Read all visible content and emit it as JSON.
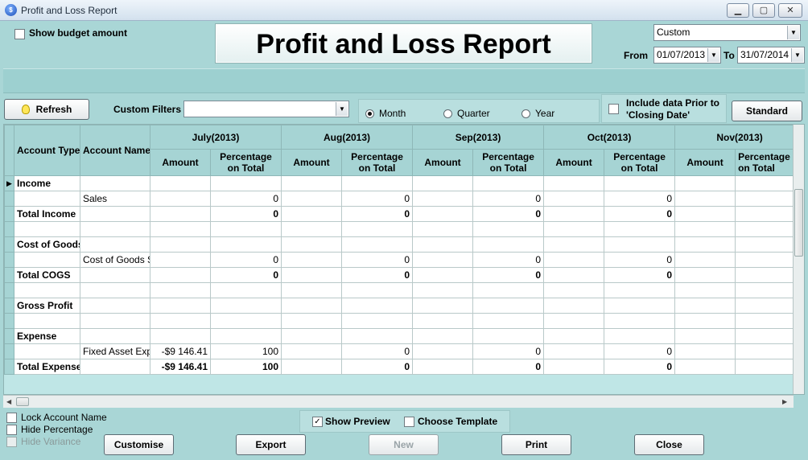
{
  "window": {
    "title": "Profit and Loss Report",
    "minimize": "▁",
    "maximize": "▢",
    "close": "✕"
  },
  "show_budget": {
    "label": "Show budget amount",
    "checked": false
  },
  "report_title": "Profit and Loss Report",
  "period": {
    "selected": "Custom"
  },
  "date_range": {
    "from_label": "From",
    "from_value": "01/07/2013",
    "to_label": "To",
    "to_value": "31/07/2014"
  },
  "toolbar": {
    "refresh_label": "Refresh",
    "custom_filters_label": "Custom Filters",
    "custom_filters_value": ""
  },
  "grouping": {
    "month": "Month",
    "quarter": "Quarter",
    "year": "Year",
    "selected": "Month"
  },
  "include_prior": {
    "label_line1": "Include data Prior to",
    "label_line2": "'Closing Date'",
    "checked": false
  },
  "standard_label": "Standard",
  "grid": {
    "col_account_type": "Account Type",
    "col_account_name": "Account Name",
    "months": [
      "July(2013)",
      "Aug(2013)",
      "Sep(2013)",
      "Oct(2013)",
      "Nov(2013)"
    ],
    "amount_header": "Amount",
    "percent_header": "Percentage on Total",
    "percent_header_cut": "Percentage on Total",
    "rows": [
      {
        "type": "Income",
        "name": "",
        "vals": [
          "",
          "",
          "",
          "",
          "",
          "",
          "",
          "",
          "",
          ""
        ],
        "bold": true,
        "current": true
      },
      {
        "type": "",
        "name": "Sales",
        "vals": [
          "",
          "0",
          "",
          "0",
          "",
          "0",
          "",
          "0",
          "",
          ""
        ],
        "bold": false
      },
      {
        "type": "Total Income",
        "name": "",
        "vals": [
          "",
          "0",
          "",
          "0",
          "",
          "0",
          "",
          "0",
          "",
          ""
        ],
        "bold": true
      },
      {
        "type": "",
        "name": "",
        "vals": [
          "",
          "",
          "",
          "",
          "",
          "",
          "",
          "",
          "",
          ""
        ],
        "bold": false
      },
      {
        "type": "Cost of Goods",
        "name": "",
        "vals": [
          "",
          "",
          "",
          "",
          "",
          "",
          "",
          "",
          "",
          ""
        ],
        "bold": true
      },
      {
        "type": "",
        "name": "Cost of Goods S",
        "vals": [
          "",
          "0",
          "",
          "0",
          "",
          "0",
          "",
          "0",
          "",
          ""
        ],
        "bold": false
      },
      {
        "type": "Total COGS",
        "name": "",
        "vals": [
          "",
          "0",
          "",
          "0",
          "",
          "0",
          "",
          "0",
          "",
          ""
        ],
        "bold": true
      },
      {
        "type": "",
        "name": "",
        "vals": [
          "",
          "",
          "",
          "",
          "",
          "",
          "",
          "",
          "",
          ""
        ],
        "bold": false
      },
      {
        "type": "Gross Profit",
        "name": "",
        "vals": [
          "",
          "",
          "",
          "",
          "",
          "",
          "",
          "",
          "",
          ""
        ],
        "bold": true
      },
      {
        "type": "",
        "name": "",
        "vals": [
          "",
          "",
          "",
          "",
          "",
          "",
          "",
          "",
          "",
          ""
        ],
        "bold": false
      },
      {
        "type": "Expense",
        "name": "",
        "vals": [
          "",
          "",
          "",
          "",
          "",
          "",
          "",
          "",
          "",
          ""
        ],
        "bold": true
      },
      {
        "type": "",
        "name": "Fixed Asset Exp",
        "vals": [
          "-$9 146.41",
          "100",
          "",
          "0",
          "",
          "0",
          "",
          "0",
          "",
          ""
        ],
        "bold": false
      },
      {
        "type": "Total Expense",
        "name": "",
        "vals": [
          "-$9 146.41",
          "100",
          "",
          "0",
          "",
          "0",
          "",
          "0",
          "",
          ""
        ],
        "bold": true
      }
    ]
  },
  "options": {
    "lock_account_name": "Lock Account Name",
    "hide_percentage": "Hide Percentage",
    "hide_variance": "Hide Variance"
  },
  "preview": {
    "show_preview": "Show Preview",
    "show_preview_checked": true,
    "choose_template": "Choose Template",
    "choose_template_checked": false
  },
  "buttons": {
    "customise": "Customise",
    "export": "Export",
    "new": "New",
    "print": "Print",
    "close": "Close"
  }
}
